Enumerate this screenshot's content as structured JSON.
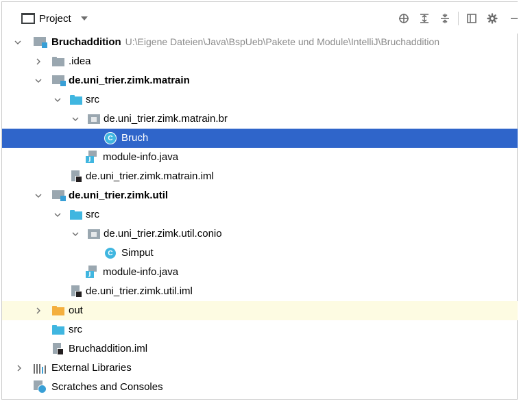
{
  "toolbar": {
    "title": "Project"
  },
  "tree": {
    "root": {
      "label": "Bruchaddition",
      "path": "U:\\Eigene Dateien\\Java\\BspUeb\\Pakete und Module\\IntelliJ\\Bruchaddition"
    },
    "idea": ".idea",
    "m1": {
      "label": "de.uni_trier.zimk.matrain",
      "src": "src",
      "pkg": "de.uni_trier.zimk.matrain.br",
      "cls": "Bruch",
      "info": "module-info.java",
      "iml": "de.uni_trier.zimk.matrain.iml"
    },
    "m2": {
      "label": "de.uni_trier.zimk.util",
      "src": "src",
      "pkg": "de.uni_trier.zimk.util.conio",
      "cls": "Simput",
      "info": "module-info.java",
      "iml": "de.uni_trier.zimk.util.iml"
    },
    "out": "out",
    "src": "src",
    "iml": "Bruchaddition.iml",
    "libs": "External Libraries",
    "scratches": "Scratches and Consoles"
  },
  "colors": {
    "selection": "#2f65ca",
    "ignored_row": "#fdfbe2",
    "path_gray": "#8a8a8a"
  },
  "icons": [
    "project-icon",
    "locate-icon",
    "expand-all-icon",
    "collapse-all-icon",
    "layout-icon",
    "gear-icon",
    "minimize-icon"
  ]
}
